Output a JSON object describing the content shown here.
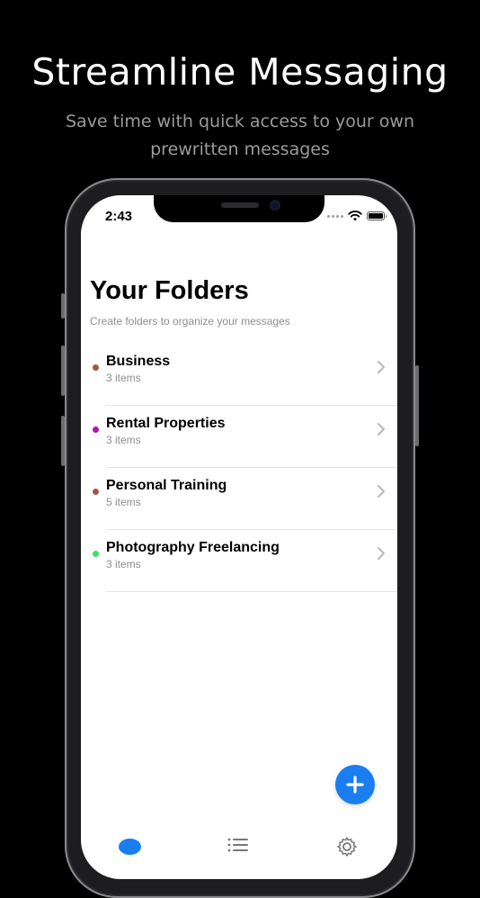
{
  "promo": {
    "headline": "Streamline Messaging",
    "subline": "Save time with quick access to your own prewritten messages"
  },
  "status_bar": {
    "time": "2:43"
  },
  "screen": {
    "title": "Your Folders",
    "caption": "Create folders to organize your messages"
  },
  "folders": [
    {
      "name": "Business",
      "count": "3 items",
      "color": "#a0584a"
    },
    {
      "name": "Rental Properties",
      "count": "3 items",
      "color": "#b0179d"
    },
    {
      "name": "Personal Training",
      "count": "5 items",
      "color": "#a0584a"
    },
    {
      "name": "Photography Freelancing",
      "count": "3 items",
      "color": "#3ee068"
    }
  ],
  "theme": {
    "accent": "#1a7df0"
  },
  "icons": {
    "fab": "plus-icon",
    "tabs": [
      "home-icon",
      "list-icon",
      "gear-icon"
    ]
  }
}
